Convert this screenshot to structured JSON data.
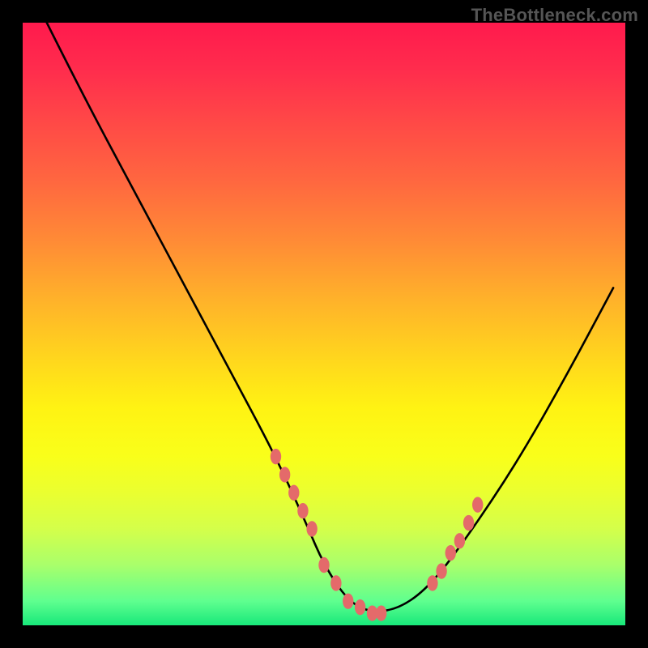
{
  "watermark": "TheBottleneck.com",
  "chart_data": {
    "type": "line",
    "title": "",
    "xlabel": "",
    "ylabel": "",
    "xlim": [
      0,
      100
    ],
    "ylim": [
      0,
      100
    ],
    "grid": false,
    "legend": false,
    "series": [
      {
        "name": "bottleneck-curve",
        "x": [
          4,
          10,
          18,
          26,
          34,
          42,
          47,
          50,
          54,
          58,
          63,
          68,
          74,
          82,
          90,
          98
        ],
        "y": [
          100,
          88,
          73,
          58,
          43,
          28,
          17,
          10,
          4,
          2,
          3,
          7,
          15,
          27,
          41,
          56
        ],
        "color": "#000000"
      },
      {
        "name": "highlight-dots-left",
        "type": "scatter",
        "x": [
          42,
          43.5,
          45,
          46.5,
          48,
          50,
          52,
          54,
          56,
          58,
          59.5
        ],
        "y": [
          28,
          25,
          22,
          19,
          16,
          10,
          7,
          4,
          3,
          2,
          2
        ],
        "color": "#e46a6a"
      },
      {
        "name": "highlight-dots-right",
        "type": "scatter",
        "x": [
          68,
          69.5,
          71,
          72.5,
          74,
          75.5
        ],
        "y": [
          7,
          9,
          12,
          14,
          17,
          20
        ],
        "color": "#e46a6a"
      }
    ],
    "annotations": []
  },
  "colors": {
    "background": "#000000",
    "gradient_top": "#ff1a4d",
    "gradient_bottom": "#18e87a",
    "curve": "#000000",
    "dots": "#e46a6a",
    "watermark": "#555555"
  }
}
